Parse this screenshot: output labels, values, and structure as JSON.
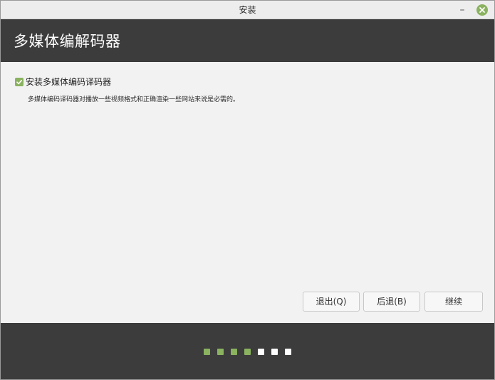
{
  "window": {
    "title": "安装"
  },
  "header": {
    "title": "多媒体编解码器"
  },
  "codecs": {
    "checkbox_label": "安装多媒体编码译码器",
    "checked": true,
    "description": "多媒体编码译码器对播放一些视频格式和正确渲染一些网站来说是必需的。"
  },
  "buttons": {
    "quit": "退出(Q)",
    "back": "后退(B)",
    "continue": "继续"
  },
  "progress": {
    "completed_steps": 4,
    "total_steps": 7
  },
  "colors": {
    "accent": "#8ab25f",
    "dark_bar": "#3c3c3c",
    "content_bg": "#f2f2f2"
  }
}
